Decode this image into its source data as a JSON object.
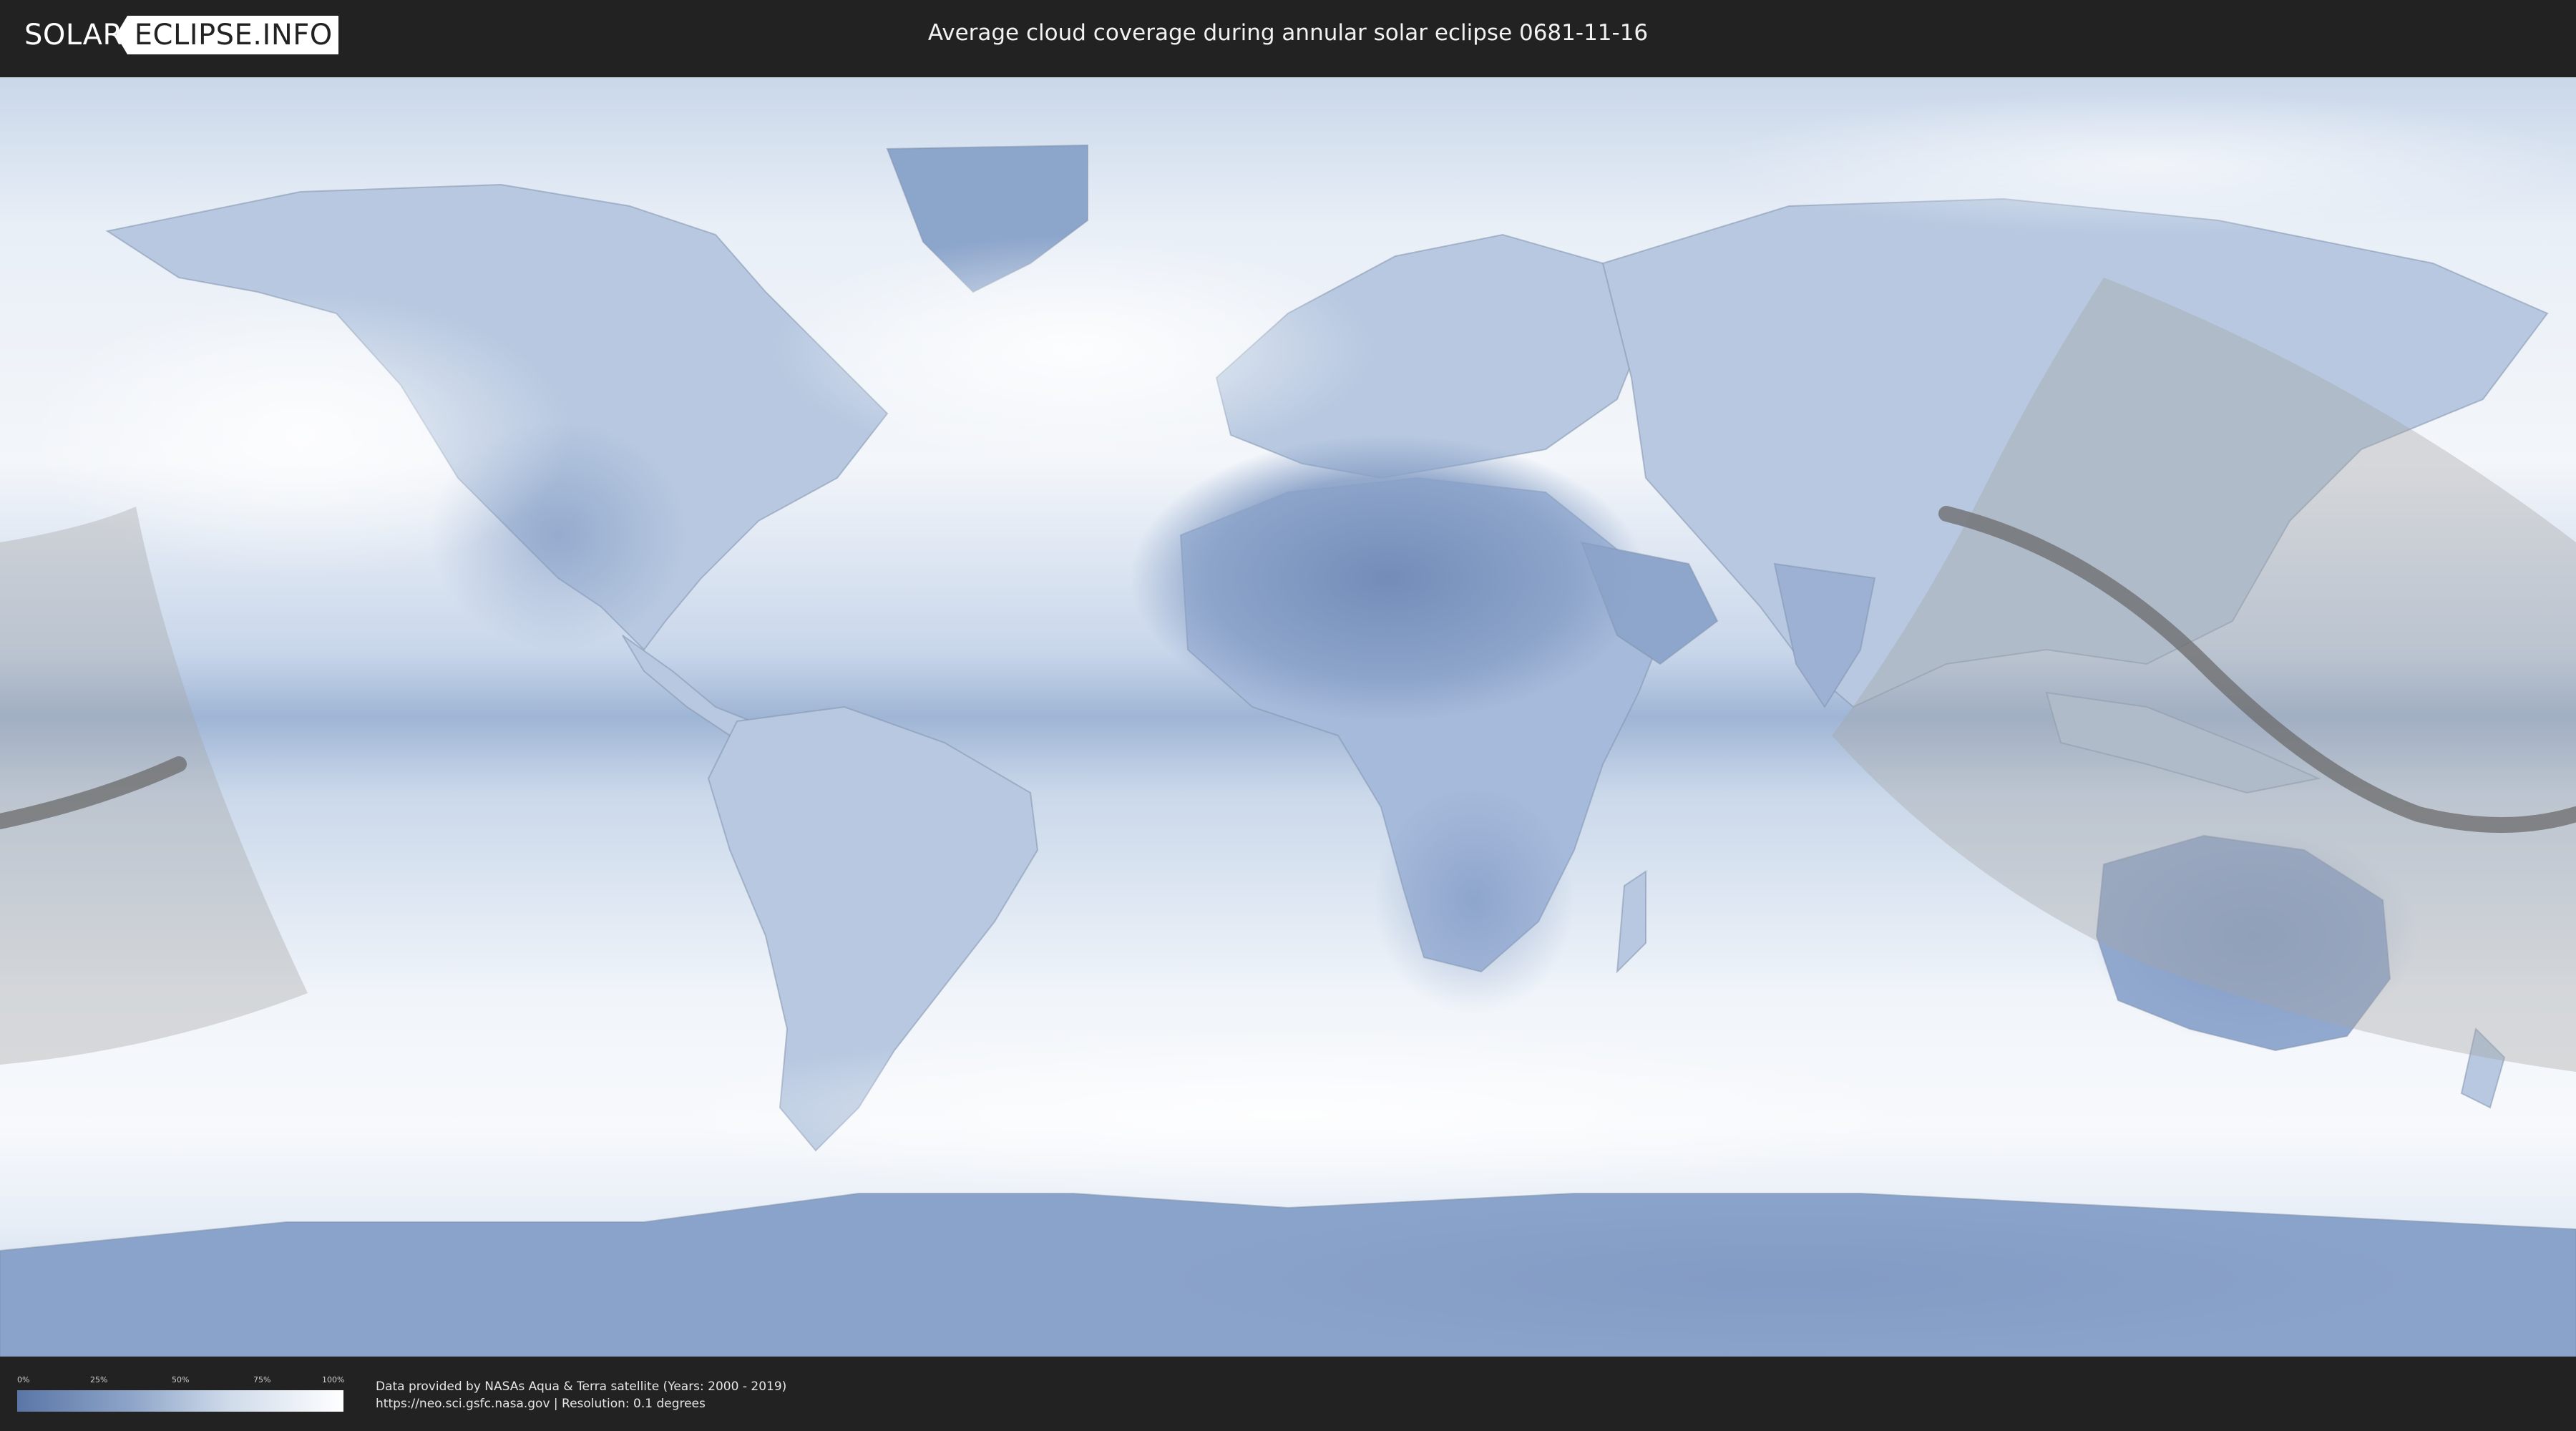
{
  "header": {
    "logo_left": "SOLAR",
    "logo_right": "ECLIPSE.INFO",
    "title": "Average cloud coverage during annular solar eclipse 0681-11-16"
  },
  "legend": {
    "ticks": [
      "0%",
      "25%",
      "50%",
      "75%",
      "100%"
    ],
    "gradient_from": "#5a76a6",
    "gradient_to": "#ffffff"
  },
  "footer": {
    "line1": "Data provided by NASAs Aqua & Terra satellite (Years: 2000 - 2019)",
    "line2": "https://neo.sci.gsfc.nasa.gov | Resolution: 0.1 degrees"
  },
  "colors": {
    "background": "#222222",
    "map_base": "#dde7f3",
    "cloud_dense": "#ffffff",
    "cloud_clear": "#5f7cab",
    "eclipse_zone": "#a6a6a6",
    "eclipse_path": "#6b6b6b"
  }
}
